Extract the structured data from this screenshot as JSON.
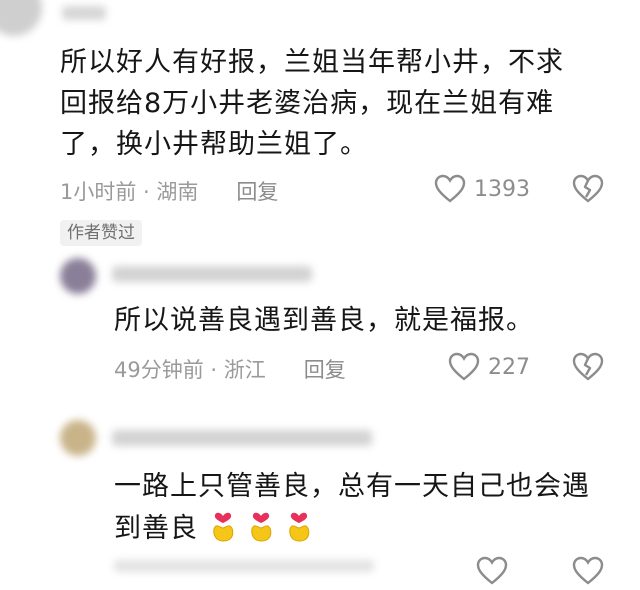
{
  "comments": [
    {
      "text": "所以好人有好报，兰姐当年帮小井，不求回报给8万小井老婆治病，现在兰姐有难了，换小井帮助兰姐了。",
      "lines": [
        "所以好人有好报，兰姐当年帮小井，不求",
        "回报给8万小井老婆治病，现在兰姐有难",
        "了，换小井帮助兰姐了。"
      ],
      "time_location": "1小时前 · 湖南",
      "reply_label": "回复",
      "likes": "1393",
      "badge": "作者赞过"
    },
    {
      "text": "所以说善良遇到善良，就是福报。",
      "lines": [
        "所以说善良遇到善良，就是福报。"
      ],
      "time_location": "49分钟前 · 浙江",
      "reply_label": "回复",
      "likes": "227"
    },
    {
      "text": "一路上只管善良，总有一天自己也会遇到善良",
      "lines": [
        "一路上只管善良，总有一天自己也会遇",
        "到善良"
      ],
      "emoji_icons": [
        "finger-heart-icon",
        "finger-heart-icon",
        "finger-heart-icon"
      ]
    }
  ],
  "colors": {
    "text": "#161616",
    "meta": "#9a9a9a",
    "badge_bg": "#f1f1f1",
    "emoji_yellow": "#f5c518",
    "emoji_heart": "#e8305a"
  }
}
